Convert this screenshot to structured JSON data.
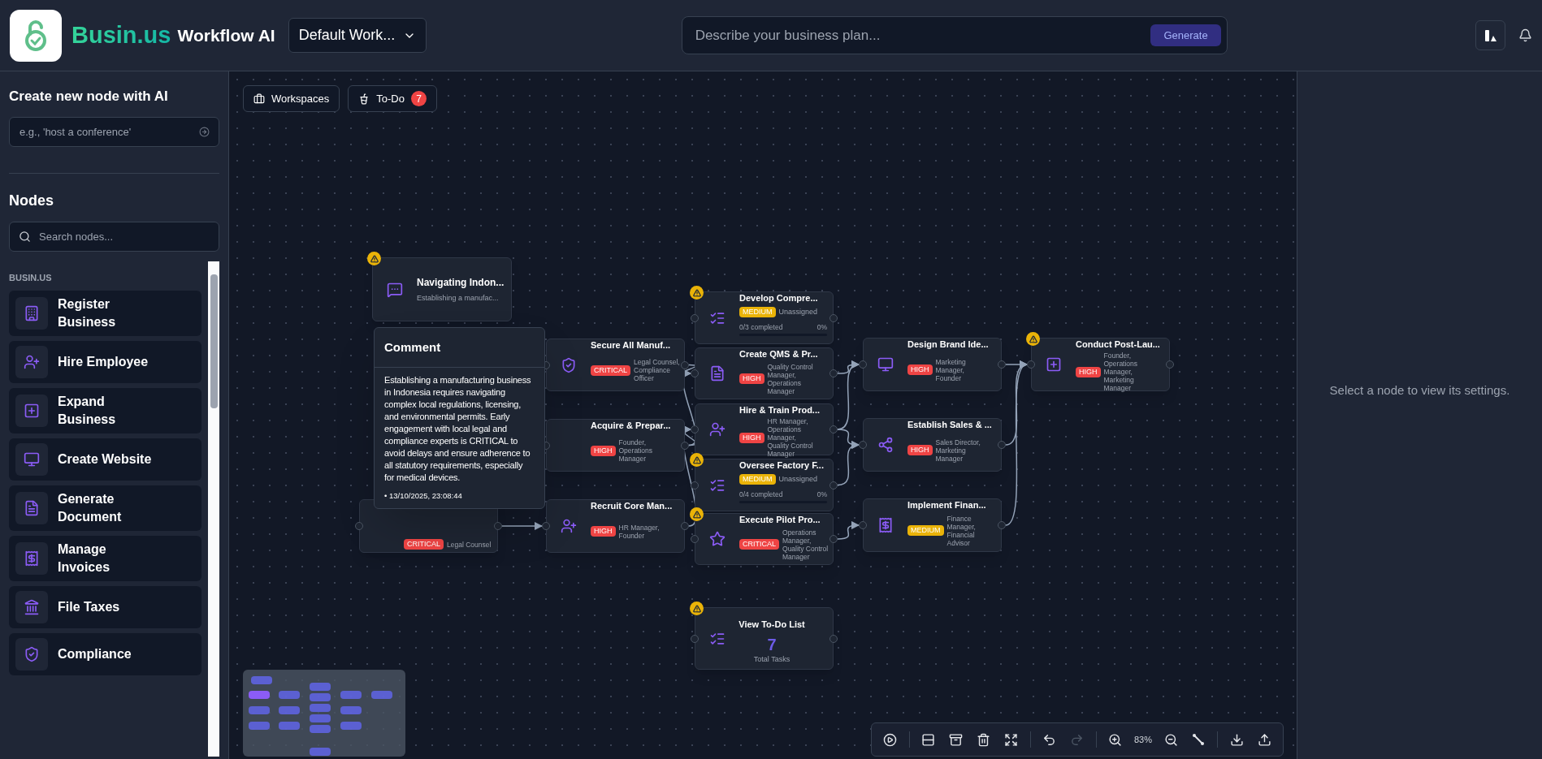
{
  "header": {
    "brand": "Busin.us",
    "title": "Workflow AI",
    "workspace_select": "Default Work...",
    "plan_field": {
      "placeholder": "Describe your business plan..."
    },
    "generate_button": "Generate"
  },
  "sidebar": {
    "ai_title": "Create new node with AI",
    "ai_field": {
      "placeholder": "e.g., 'host a conference'"
    },
    "nodes_title": "Nodes",
    "search": {
      "placeholder": "Search nodes..."
    },
    "section": "BUSIN.US",
    "items": [
      {
        "label": "Register Business"
      },
      {
        "label": "Hire Employee"
      },
      {
        "label": "Expand Business"
      },
      {
        "label": "Create Website"
      },
      {
        "label": "Generate Document"
      },
      {
        "label": "Manage Invoices"
      },
      {
        "label": "File Taxes"
      },
      {
        "label": "Compliance"
      }
    ]
  },
  "canvas": {
    "buttons": [
      {
        "label": "Workspaces"
      },
      {
        "label": "To-Do",
        "badge": "7"
      }
    ],
    "nodes": [
      {
        "kind": "comment",
        "warning": true,
        "title": "Navigating Indon...",
        "subtitle": "Establishing a manufac..."
      },
      {
        "kind": "task",
        "warning": false,
        "priority": "CRITICAL",
        "color": "#ef4444",
        "assignees": "Legal Counsel"
      },
      {
        "kind": "task",
        "warning": false,
        "title": "Secure All Manuf...",
        "priority": "CRITICAL",
        "color": "#ef4444",
        "assignees": "Legal Counsel, Compliance Officer"
      },
      {
        "kind": "task",
        "warning": false,
        "title": "Acquire & Prepar...",
        "priority": "HIGH",
        "color": "#ef4444",
        "assignees": "Founder, Operations Manager"
      },
      {
        "kind": "task",
        "warning": false,
        "title": "Recruit Core Man...",
        "priority": "HIGH",
        "color": "#ef4444",
        "assignees": "HR Manager, Founder"
      },
      {
        "kind": "checklist",
        "warning": true,
        "title": "Develop Compre...",
        "priority": "MEDIUM",
        "color": "#eab308",
        "assignees": "Unassigned",
        "progress": "0/3 completed",
        "percent": "0%",
        "level": 0
      },
      {
        "kind": "task",
        "warning": false,
        "title": "Create QMS & Pr...",
        "priority": "HIGH",
        "color": "#ef4444",
        "assignees": "Quality Control Manager, Operations Manager"
      },
      {
        "kind": "task",
        "warning": false,
        "title": "Hire & Train Prod...",
        "priority": "HIGH",
        "color": "#ef4444",
        "assignees": "HR Manager, Operations Manager, Quality Control Manager"
      },
      {
        "kind": "checklist",
        "warning": true,
        "title": "Oversee Factory F...",
        "priority": "MEDIUM",
        "color": "#eab308",
        "assignees": "Unassigned",
        "progress": "0/4 completed",
        "percent": "0%",
        "level": 0
      },
      {
        "kind": "task",
        "warning": true,
        "title": "Execute Pilot Pro...",
        "priority": "CRITICAL",
        "color": "#ef4444",
        "assignees": "Operations Manager, Quality Control Manager"
      },
      {
        "kind": "todo",
        "warning": true,
        "title": "View To-Do List",
        "count": "7",
        "caption": "Total Tasks"
      },
      {
        "kind": "task",
        "warning": false,
        "title": "Design Brand Ide...",
        "priority": "HIGH",
        "color": "#ef4444",
        "assignees": "Marketing Manager, Founder"
      },
      {
        "kind": "task",
        "warning": false,
        "title": "Establish Sales & ...",
        "priority": "HIGH",
        "color": "#ef4444",
        "assignees": "Sales Director, Marketing Manager"
      },
      {
        "kind": "task",
        "warning": false,
        "title": "Implement Finan...",
        "priority": "MEDIUM",
        "color": "#eab308",
        "assignees": "Finance Manager, Financial Advisor"
      },
      {
        "kind": "task",
        "warning": true,
        "title": "Conduct Post-Lau...",
        "priority": "HIGH",
        "color": "#ef4444",
        "assignees": "Founder, Operations Manager, Marketing Manager"
      }
    ],
    "comment_popover": {
      "title": "Comment",
      "text": "Establishing a manufacturing business in Indonesia requires navigating complex local regulations, licensing, and environmental permits. Early engagement with local legal and compliance experts is CRITICAL to avoid delays and ensure adherence to all statutory requirements, especially for medical devices.",
      "timestamp": "• 13/10/2025, 23:08:44"
    },
    "toolbar": {
      "zoom": "83%",
      "undo_disabled": false,
      "redo_disabled": true
    }
  },
  "settings_panel": {
    "empty_text": "Select a node to view its settings."
  }
}
